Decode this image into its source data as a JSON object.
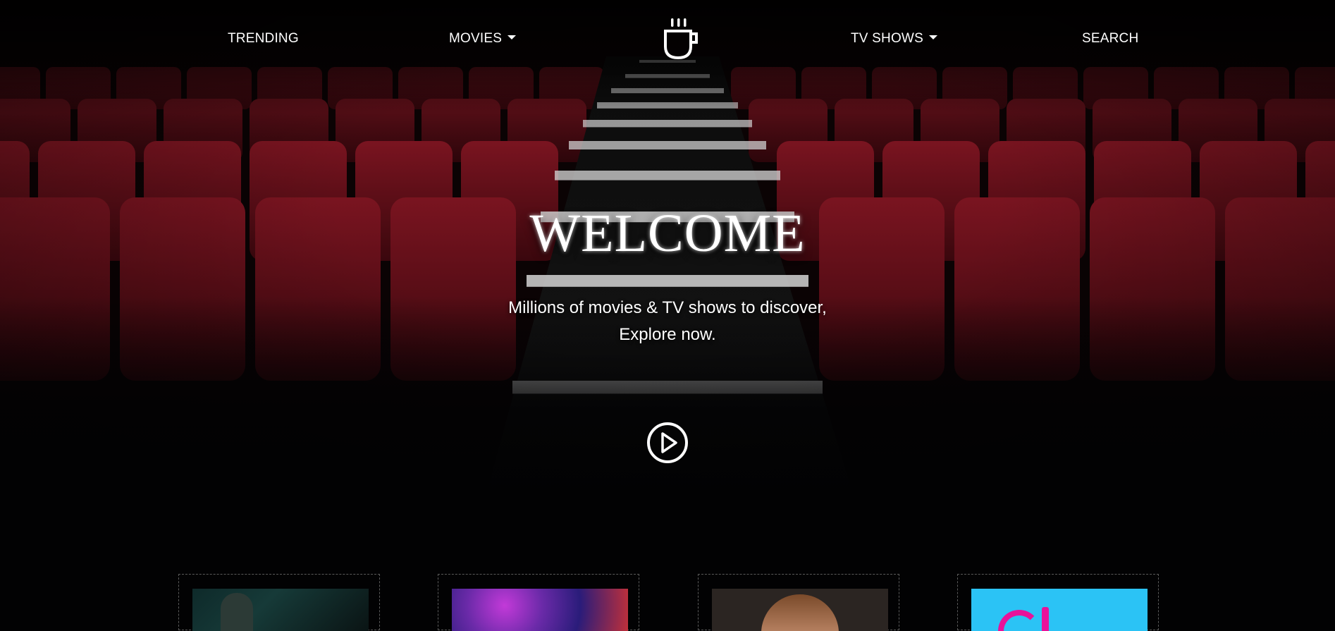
{
  "nav": {
    "trending": "TRENDING",
    "movies": "MOVIES",
    "tv_shows": "TV SHOWS",
    "search": "SEARCH",
    "logo_icon": "coffee-cup-icon",
    "dropdown_icon": "caret-down-icon"
  },
  "hero": {
    "title": "WELCOME",
    "subtitle_line1": "Millions of movies & TV shows to discover,",
    "subtitle_line2": "Explore now.",
    "play_icon": "play-circle-icon",
    "background": "cinema-seats-image"
  },
  "cards": [
    {
      "poster": "dark-teal-portrait"
    },
    {
      "poster": "purple-galaxy"
    },
    {
      "poster": "boy-portrait"
    },
    {
      "poster": "cyan-pink-title"
    }
  ],
  "colors": {
    "background": "#020203",
    "seat_red": "#6e0f18",
    "text": "#ffffff",
    "card_border": "#5a5a5a"
  }
}
